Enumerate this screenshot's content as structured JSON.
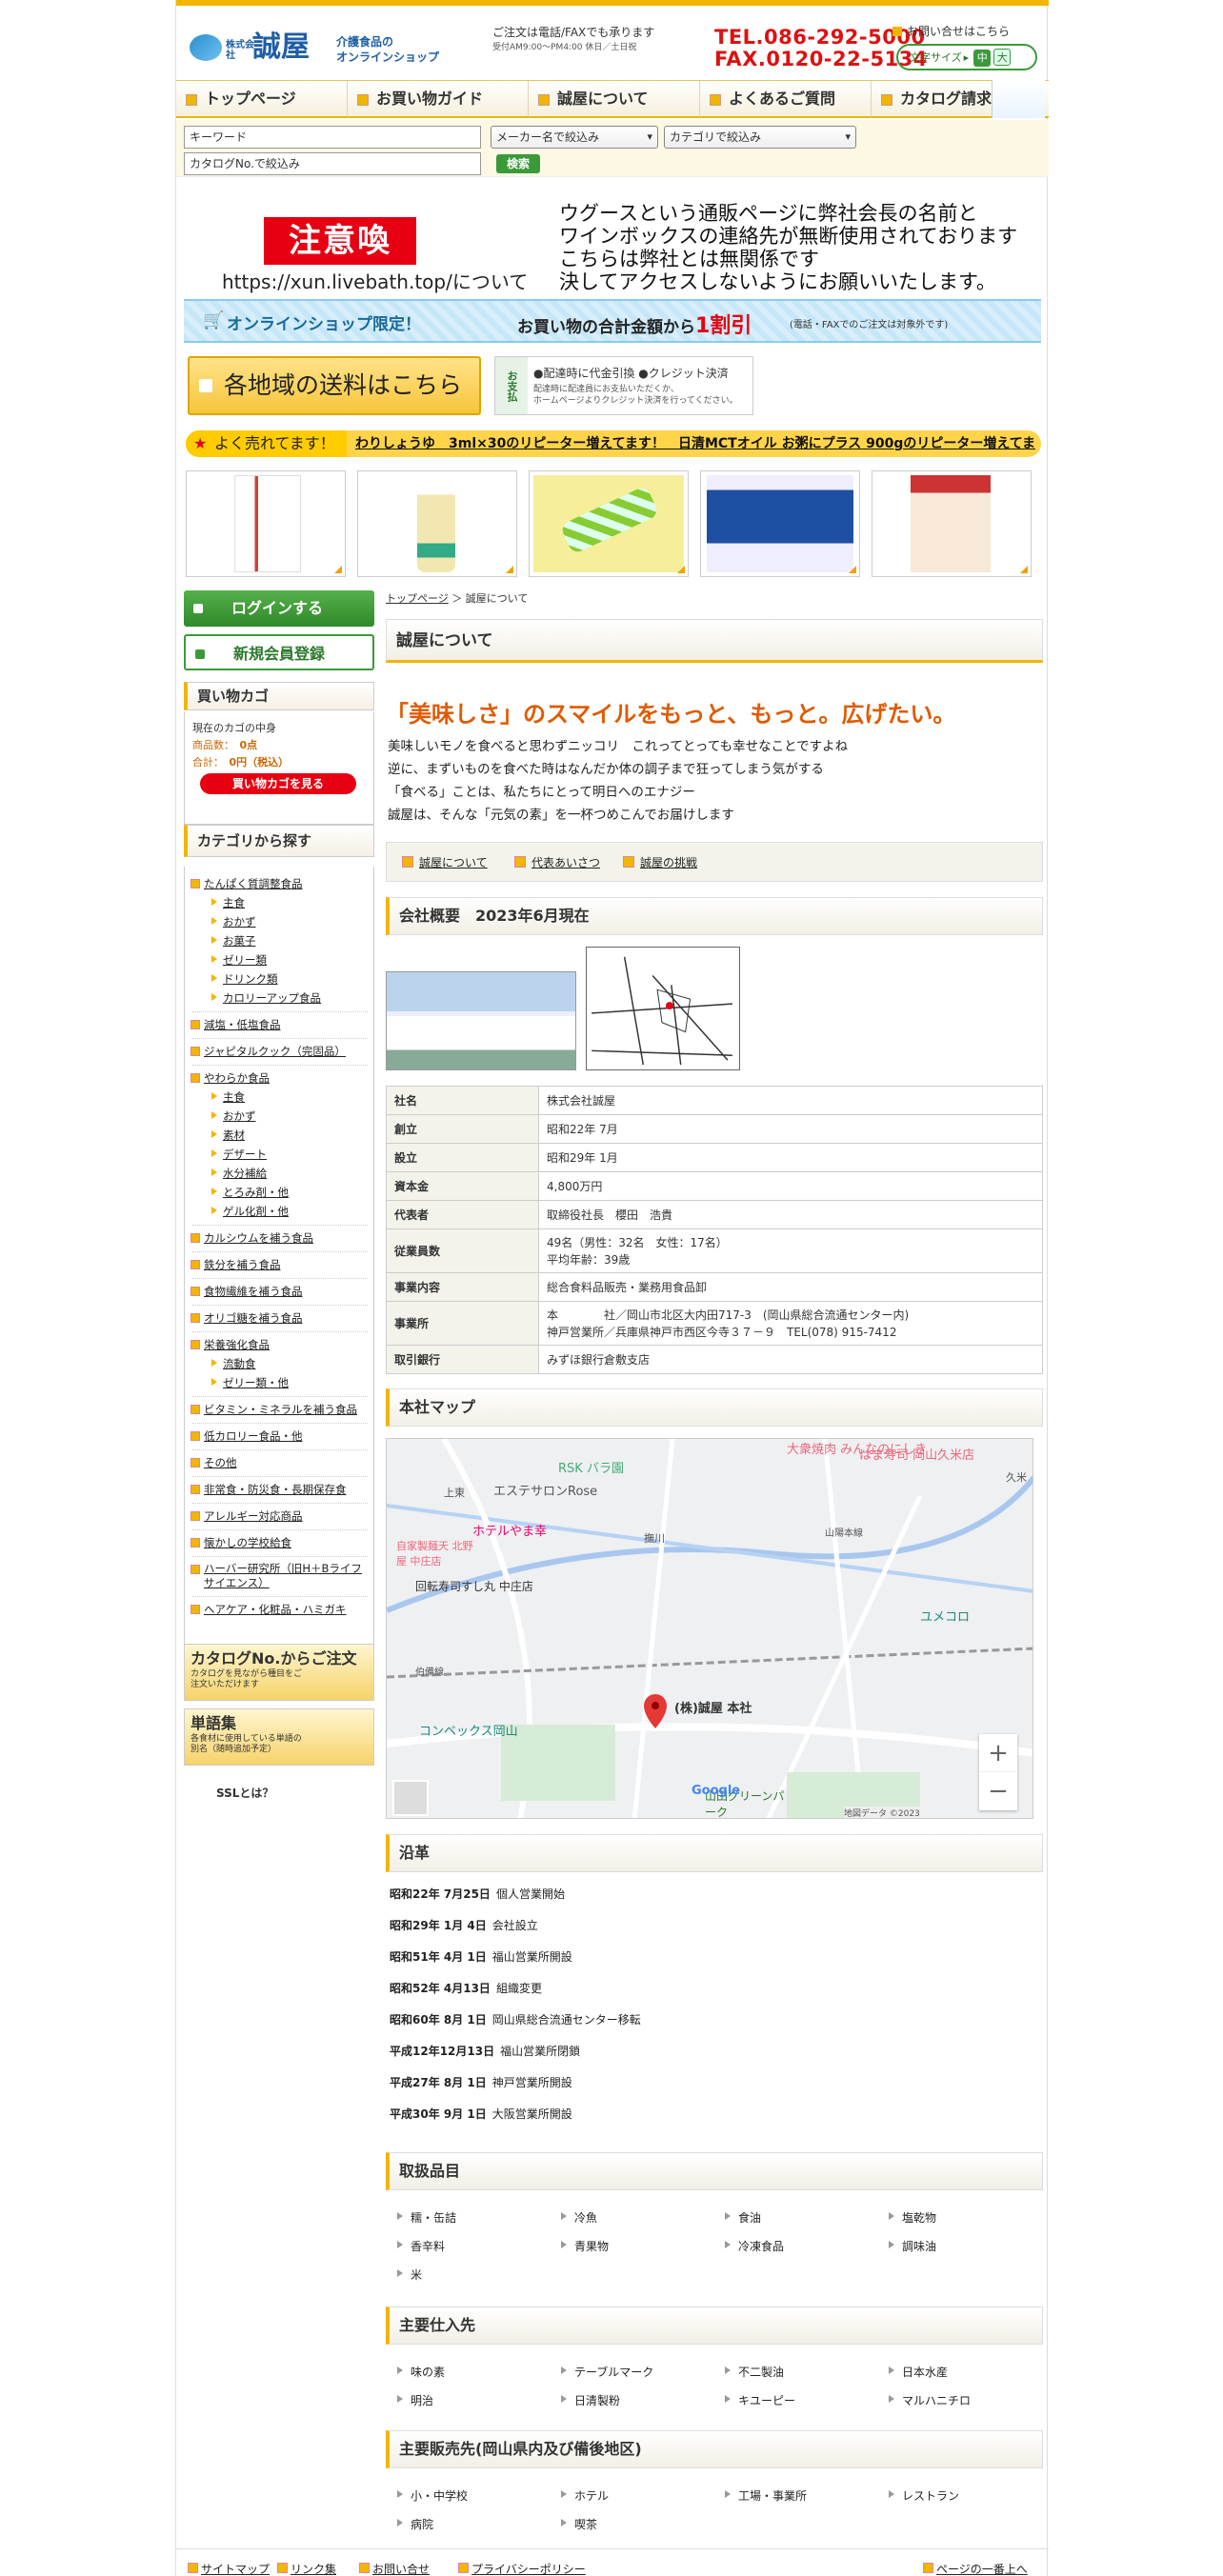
{
  "header": {
    "logo_small": "株式会社",
    "logo_name": "誠屋",
    "tagline_1": "介護食品の",
    "tagline_2": "オンラインショップ",
    "order_line": "ご注文は電話/FAXでも承ります",
    "hours": "受付AM9:00〜PM4:00 休日／土日祝",
    "tel": "TEL.086-292-5000",
    "fax": "FAX.0120-22-5134",
    "inquiry": "お問い合せはこちら",
    "fontsize_label": "文字サイズ",
    "fontsize_mid": "中",
    "fontsize_big": "大"
  },
  "nav": [
    "トップページ",
    "お買い物ガイド",
    "誠屋について",
    "よくあるご質問",
    "カタログ請求"
  ],
  "search": {
    "keyword_placeholder": "キーワード",
    "maker_select": "メーカー名で絞込み",
    "category_select": "カテゴリで絞込み",
    "catalog_placeholder": "カタログNo.で絞込み",
    "button": "検索"
  },
  "warning": {
    "title": "注意喚起！",
    "url_line": "https://xun.livebath.top/について",
    "lines": [
      "ウグースという通販ページに弊社会長の名前と",
      "ワインボックスの連絡先が無断使用されております",
      "こちらは弊社とは無関係です",
      "決してアクセスしないようにお願いいたします。"
    ]
  },
  "promo": {
    "left": "オンラインショップ限定！",
    "mid": "お買い物の合計金額から",
    "highlight": "1割引",
    "note": "(電話・FAXでのご注文は対象外です)"
  },
  "shipping_banner": "各地域の送料はこちら",
  "payment": {
    "label": "お支払",
    "line1": "●配達時に代金引換 ●クレジット決済",
    "line2a": "配達時に配達員にお支払いただくか、",
    "line2b": "ホームページよりクレジット決済を行ってください。"
  },
  "ticker": {
    "label": "よく売れてます！",
    "text": "わりしょうゆ　3ml×30のリピーター増えてます！　日清MCTオイル お粥にプラス 900gのリピーター増えてま"
  },
  "sidebar": {
    "login": "ログインする",
    "register": "新規会員登録",
    "cart_title": "買い物カゴ",
    "cart_status": "現在のカゴの中身",
    "cart_count_label": "商品数：",
    "cart_count": "0点",
    "cart_total_label": "合計：",
    "cart_total": "0円（税込）",
    "cart_button": "買い物カゴを見る",
    "category_title": "カテゴリから探す",
    "categories": [
      {
        "label": "たんぱく質調整食品",
        "level": 1
      },
      {
        "label": "主食",
        "level": 2
      },
      {
        "label": "おかず",
        "level": 2
      },
      {
        "label": "お菓子",
        "level": 2
      },
      {
        "label": "ゼリー類",
        "level": 2
      },
      {
        "label": "ドリンク類",
        "level": 2
      },
      {
        "label": "カロリーアップ食品",
        "level": 2
      },
      {
        "label": "減塩・低塩食品",
        "level": 1
      },
      {
        "label": "ジャピタルクック（完固品）",
        "level": 1
      },
      {
        "label": "やわらか食品",
        "level": 1
      },
      {
        "label": "主食",
        "level": 2
      },
      {
        "label": "おかず",
        "level": 2
      },
      {
        "label": "素材",
        "level": 2
      },
      {
        "label": "デザート",
        "level": 2
      },
      {
        "label": "水分補給",
        "level": 2
      },
      {
        "label": "とろみ剤・他",
        "level": 2
      },
      {
        "label": "ゲル化剤・他",
        "level": 2
      },
      {
        "label": "カルシウムを補う食品",
        "level": 1
      },
      {
        "label": "鉄分を補う食品",
        "level": 1
      },
      {
        "label": "食物繊維を補う食品",
        "level": 1
      },
      {
        "label": "オリゴ糖を補う食品",
        "level": 1
      },
      {
        "label": "栄養強化食品",
        "level": 1
      },
      {
        "label": "流動食",
        "level": 2
      },
      {
        "label": "ゼリー類・他",
        "level": 2
      },
      {
        "label": "ビタミン・ミネラルを補う食品",
        "level": 1
      },
      {
        "label": "低カロリー食品・他",
        "level": 1
      },
      {
        "label": "その他",
        "level": 1
      },
      {
        "label": "非常食・防災食・長期保存食",
        "level": 1
      },
      {
        "label": "アレルギー対応商品",
        "level": 1
      },
      {
        "label": "懐かしの学校給食",
        "level": 1
      },
      {
        "label": "ハーバー研究所（旧H＋Bライフサイエンス）",
        "level": 1
      },
      {
        "label": "ヘアケア・化粧品・ハミガキ",
        "level": 1
      }
    ],
    "catalog_banner": "カタログNo.からご注文",
    "catalog_banner_sub": "カタログを見ながら種目をご注文いただけます",
    "vocab_banner": "単語集",
    "vocab_banner_sub": "各食材に使用している単語の別名（随時追加予定）",
    "ssl": "SSLとは？"
  },
  "main": {
    "breadcrumb_home": "トップページ",
    "breadcrumb_sep": "＞",
    "breadcrumb_current": "誠屋について",
    "page_title": "誠屋について",
    "catch": "「美味しさ」のスマイルをもっと、もっと。広げたい。",
    "intro": [
      "美味しいモノを食べると思わずニッコリ　これってとっても幸せなことですよね",
      "逆に、まずいものを食べた時はなんだか体の調子まで狂ってしまう気がする",
      "「食べる」ことは、私たちにとって明日へのエナジー",
      "誠屋は、そんな「元気の素」を一杯つめこんでお届けします"
    ],
    "anchors": [
      "誠屋について",
      "代表あいさつ",
      "誠屋の挑戦"
    ],
    "profile_title": "会社概要　2023年6月現在",
    "profile": [
      {
        "k": "社名",
        "v": "株式会社誠屋"
      },
      {
        "k": "創立",
        "v": "昭和22年 7月"
      },
      {
        "k": "設立",
        "v": "昭和29年 1月"
      },
      {
        "k": "資本金",
        "v": "4,800万円"
      },
      {
        "k": "代表者",
        "v": "取締役社長　櫻田　浩貴"
      },
      {
        "k": "従業員数",
        "v": "49名（男性：32名　女性：17名）",
        "v2": "平均年齢：39歳"
      },
      {
        "k": "事業内容",
        "v": "総合食料品販売・業務用食品卸"
      },
      {
        "k": "事業所",
        "v": "本　　　　社／岡山市北区大内田717-3　(岡山県総合流通センター内)",
        "v2": "神戸営業所／兵庫県神戸市西区今寺３７－９　TEL(078) 915-7412"
      },
      {
        "k": "取引銀行",
        "v": "みずほ銀行倉敷支店"
      }
    ],
    "map_title": "本社マップ",
    "map_labels": {
      "pin": "(株)誠屋 本社",
      "place1": "RSK バラ園",
      "place2": "エステサロンRose",
      "place3": "ホテルやま幸",
      "place4": "回転寿司すし丸 中庄店",
      "place5": "コンベックス岡山",
      "place6": "大衆焼肉 みんなのにしき",
      "place7": "はま寿司 岡山久米店",
      "place8": "ユメコロ",
      "place9": "山田グリーンパーク",
      "place10": "自家製麺天 北野屋 中庄店",
      "road1": "山陽本線",
      "road2": "伯備線",
      "copyright": "地図データ ©2023",
      "zoom_in": "+",
      "zoom_out": "−",
      "area1": "上東",
      "area2": "撫川",
      "area3": "久米",
      "google": "Google"
    },
    "history_title": "沿革",
    "history": [
      {
        "d": "昭和22年 7月25日",
        "e": "個人営業開始"
      },
      {
        "d": "昭和29年 1月 4日",
        "e": "会社設立"
      },
      {
        "d": "昭和51年 4月 1日",
        "e": "福山営業所開設"
      },
      {
        "d": "昭和52年 4月13日",
        "e": "組織変更"
      },
      {
        "d": "昭和60年 8月 1日",
        "e": "岡山県総合流通センター移転"
      },
      {
        "d": "平成12年12月13日",
        "e": "福山営業所閉鎖"
      },
      {
        "d": "平成27年 8月 1日",
        "e": "神戸営業所開設"
      },
      {
        "d": "平成30年 9月 1日",
        "e": "大阪営業所開設"
      }
    ],
    "products_title": "取扱品目",
    "products": [
      "糯・缶詰",
      "冷魚",
      "食油",
      "塩乾物",
      "香辛料",
      "青果物",
      "冷凍食品",
      "調味油",
      "米"
    ],
    "suppliers_title": "主要仕入先",
    "suppliers": [
      "味の素",
      "テーブルマーク",
      "不二製油",
      "日本水産",
      "明治",
      "日清製粉",
      "キユーピー",
      "マルハニチロ"
    ],
    "customers_title": "主要販売先(岡山県内及び備後地区)",
    "customers": [
      "小・中学校",
      "ホテル",
      "工場・事業所",
      "レストラン",
      "病院",
      "喫茶"
    ]
  },
  "footer": {
    "links": [
      "サイトマップ",
      "リンク集",
      "お問い合せ",
      "プライバシーポリシー"
    ],
    "pagetop": "ページの一番上へ"
  }
}
